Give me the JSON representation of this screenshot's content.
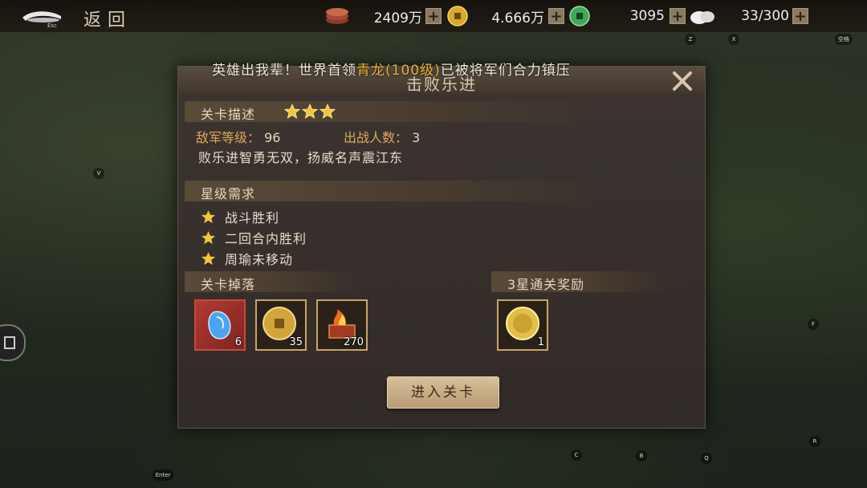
{
  "topbar": {
    "esc_label": "Esc",
    "back_label": "返回",
    "resources": [
      {
        "icon": "copper-coin-stack-icon",
        "value": "2409万"
      },
      {
        "icon": "gold-coin-icon",
        "value": "4.666万"
      },
      {
        "icon": "jade-coin-icon",
        "value": "3095"
      },
      {
        "icon": "stamina-bun-icon",
        "value": "33/300"
      }
    ]
  },
  "keys": {
    "z": "Z",
    "x": "X",
    "space": "空格",
    "v": "V",
    "f": "F",
    "c": "C",
    "b": "B",
    "q": "Q",
    "r": "R",
    "enter": "Enter"
  },
  "marquee": {
    "pre": "英雄出我辈！世界首领",
    "highlight": "青龙(100级)",
    "post": "已被将军们合力镇压"
  },
  "dialog": {
    "title": "击败乐进",
    "stage_desc_title": "关卡描述",
    "stars": 3,
    "enemy_level_label": "敌军等级：",
    "enemy_level": "96",
    "deploy_label": "出战人数：",
    "deploy_count": "3",
    "description": "败乐进智勇无双，扬威名声震江东",
    "star_req_title": "星级需求",
    "requirements": [
      "战斗胜利",
      "二回合内胜利",
      "周瑜未移动"
    ],
    "drops_title": "关卡掉落",
    "drops": [
      {
        "icon": "blue-crystal-icon",
        "count": "6"
      },
      {
        "icon": "gold-coin-icon",
        "count": "35"
      },
      {
        "icon": "fire-chest-icon",
        "count": "270"
      }
    ],
    "reward_title": "3星通关奖励",
    "rewards": [
      {
        "icon": "gold-medal-icon",
        "count": "1"
      }
    ],
    "enter_button": "进入关卡"
  },
  "colors": {
    "accent_gold": "#e8b23a",
    "label_orange": "#e0a85a",
    "button": "#d7c09c"
  }
}
